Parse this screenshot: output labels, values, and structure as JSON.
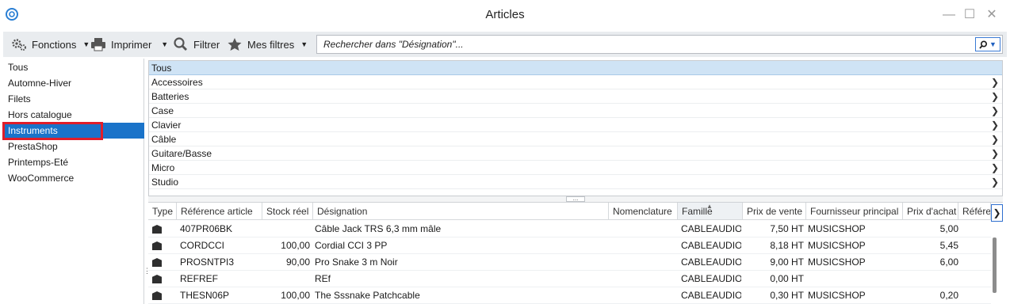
{
  "window": {
    "title": "Articles",
    "minimize_icon": "minimize-icon",
    "maximize_icon": "maximize-icon",
    "close_icon": "close-icon"
  },
  "toolbar": {
    "functions_label": "Fonctions",
    "print_label": "Imprimer",
    "filter_label": "Filtrer",
    "my_filters_label": "Mes filtres",
    "search_placeholder": "Rechercher dans \"Désignation\"..."
  },
  "left_list": {
    "items": [
      "Tous",
      "Automne-Hiver",
      "Filets",
      "Hors catalogue",
      "Instruments",
      "PrestaShop",
      "Printemps-Eté",
      "WooCommerce"
    ],
    "selected": "Instruments"
  },
  "categories": [
    "Tous",
    "Accessoires",
    "Batteries",
    "Case",
    "Clavier",
    "Câble",
    "Guitare/Basse",
    "Micro",
    "Studio"
  ],
  "grid": {
    "columns": [
      "Type",
      "Référence article",
      "Stock réel",
      "Désignation",
      "Nomenclature",
      "Famille",
      "Prix de vente",
      "Fournisseur principal",
      "Prix d'achat",
      "Référe"
    ],
    "rows": [
      {
        "ref": "407PR06BK",
        "stock": "",
        "designation": "Câble Jack TRS 6,3 mm mâle",
        "nomenclature": "",
        "famille": "CABLEAUDIO",
        "prix_vente": "7,50 HT",
        "fournisseur": "MUSICSHOP",
        "prix_achat": "5,00"
      },
      {
        "ref": "CORDCCI",
        "stock": "100,00",
        "designation": "Cordial CCI 3 PP",
        "nomenclature": "",
        "famille": "CABLEAUDIO",
        "prix_vente": "8,18 HT",
        "fournisseur": "MUSICSHOP",
        "prix_achat": "5,45"
      },
      {
        "ref": "PROSNTPI3",
        "stock": "90,00",
        "designation": "Pro Snake 3 m Noir",
        "nomenclature": "",
        "famille": "CABLEAUDIO",
        "prix_vente": "9,00 HT",
        "fournisseur": "MUSICSHOP",
        "prix_achat": "6,00"
      },
      {
        "ref": "REFREF",
        "stock": "",
        "designation": "REf",
        "nomenclature": "",
        "famille": "CABLEAUDIO",
        "prix_vente": "0,00 HT",
        "fournisseur": "",
        "prix_achat": ""
      },
      {
        "ref": "THESN06P",
        "stock": "100,00",
        "designation": "The Sssnake Patchcable",
        "nomenclature": "",
        "famille": "CABLEAUDIO",
        "prix_vente": "0,30 HT",
        "fournisseur": "MUSICSHOP",
        "prix_achat": "0,20"
      }
    ]
  },
  "colors": {
    "selection": "#1a73c9",
    "highlight_outline": "#e01e2a",
    "category_selected": "#cfe3f5"
  }
}
